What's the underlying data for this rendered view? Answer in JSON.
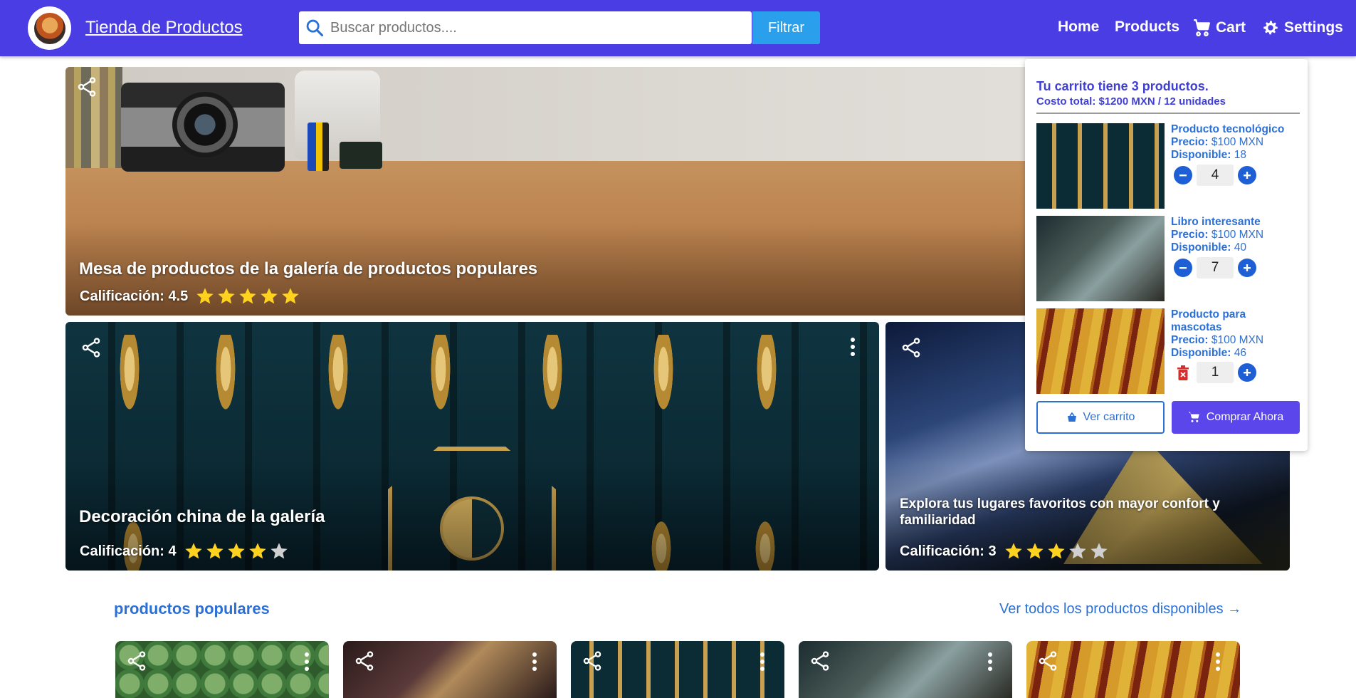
{
  "header": {
    "brand": "Tienda de Productos",
    "search_placeholder": "Buscar productos....",
    "filter_label": "Filtrar",
    "nav": {
      "home": "Home",
      "products": "Products",
      "cart": "Cart",
      "settings": "Settings"
    },
    "background_color": "#4a3de3"
  },
  "hero": [
    {
      "title": "Mesa de productos de la galería de productos populares",
      "rating_label": "Calificación: 4.5",
      "rating": 4.5
    },
    {
      "title": "Decoración china de la galería",
      "rating_label": "Calificación: 4",
      "rating": 4
    },
    {
      "title": "Explora tus lugares favoritos con mayor confort y familiaridad",
      "rating_label": "Calificación: 3",
      "rating": 3
    }
  ],
  "cart": {
    "summary_title": "Tu carrito tiene 3 productos.",
    "summary_cost_label": "Costo total:",
    "summary_cost": "$1200 MXN / 12 unidades",
    "price_label": "Precio:",
    "available_label": "Disponible:",
    "items": [
      {
        "name": "Producto tecnológico",
        "price": "$100 MXN",
        "available": "18",
        "qty": "4"
      },
      {
        "name": "Libro interesante",
        "price": "$100 MXN",
        "available": "40",
        "qty": "7"
      },
      {
        "name": "Producto para mascotas",
        "price": "$100 MXN",
        "available": "46",
        "qty": "1"
      }
    ],
    "view_cart_label": "Ver carrito",
    "buy_now_label": "Comprar Ahora"
  },
  "popular": {
    "title": "productos populares",
    "see_all": "Ver todos los productos disponibles →"
  },
  "colors": {
    "accent": "#2b70d6",
    "star": "#ffd21f",
    "star_empty": "#d0d0d0",
    "buy": "#5b46eb"
  }
}
